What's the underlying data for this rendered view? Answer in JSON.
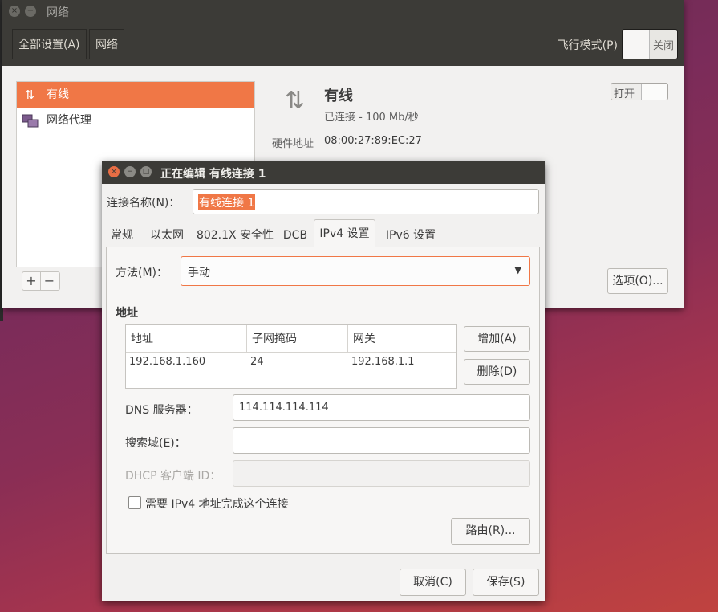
{
  "window": {
    "title": "网络",
    "crumbs": [
      "全部设置(A)",
      "网络"
    ],
    "airplane_label": "飞行模式(P)",
    "airplane_state": "关闭"
  },
  "sidebar": {
    "items": [
      {
        "label": "有线",
        "icon": "wired-network-icon"
      },
      {
        "label": "网络代理",
        "icon": "network-proxy-icon"
      }
    ],
    "add_label": "+",
    "remove_label": "−"
  },
  "device": {
    "title": "有线",
    "status": "已连接 - 100 Mb/秒",
    "hw_label": "硬件地址",
    "hw_value": "08:00:27:89:EC:27",
    "switch_label": "打开",
    "options_label": "选项(O)..."
  },
  "dialog": {
    "title": "正在编辑 有线连接 1",
    "name_label": "连接名称(N)：",
    "name_value": "有线连接 1",
    "tabs": [
      "常规",
      "以太网",
      "802.1X 安全性",
      "DCB",
      "IPv4 设置",
      "IPv6 设置"
    ],
    "active_tab": "IPv4 设置",
    "method_label": "方法(M)：",
    "method_value": "手动",
    "address_heading": "地址",
    "columns": [
      "地址",
      "子网掩码",
      "网关"
    ],
    "rows": [
      [
        "192.168.1.160",
        "24",
        "192.168.1.1"
      ]
    ],
    "add_label": "增加(A)",
    "delete_label": "删除(D)",
    "dns_label": "DNS 服务器：",
    "dns_value": "114.114.114.114",
    "search_label": "搜索域(E)：",
    "search_value": "",
    "dhcp_label": "DHCP 客户端 ID：",
    "dhcp_value": "",
    "require_label": "需要 IPv4 地址完成这个连接",
    "route_label": "路由(R)...",
    "cancel_label": "取消(C)",
    "save_label": "保存(S)"
  },
  "colors": {
    "accent": "#f07746",
    "titlebar": "#3c3b37",
    "close": "#e86d44"
  }
}
